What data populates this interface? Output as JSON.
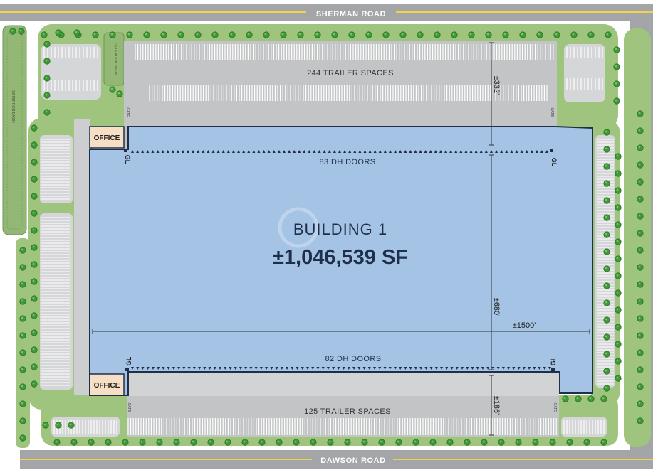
{
  "roads": {
    "north": "SHERMAN ROAD",
    "south": "DAWSON ROAD"
  },
  "building": {
    "name": "BUILDING 1",
    "area": "±1,046,539 SF"
  },
  "lots": {
    "north_trailers": "244 TRAILER SPACES",
    "south_trailers": "125 TRAILER SPACES"
  },
  "docks": {
    "north": "83 DH DOORS",
    "south": "82 DH DOORS",
    "north_count": 83,
    "south_count": 82
  },
  "dimensions": {
    "north_court": "±332'",
    "depth": "±680'",
    "width": "±1500'",
    "south_court": "±186'"
  },
  "labels": {
    "office": "OFFICE",
    "grade_level": "GL",
    "gate": "GATE",
    "detention_basin": "DETENTION BASIN"
  },
  "colors": {
    "road": "#a3a5a8",
    "landscape": "#9fc47e",
    "paving": "#d5d6d8",
    "truck_court": "#c3c4c6",
    "building": "#a5c3e4",
    "office": "#f6dfc4",
    "tree": "#3f9b35"
  }
}
